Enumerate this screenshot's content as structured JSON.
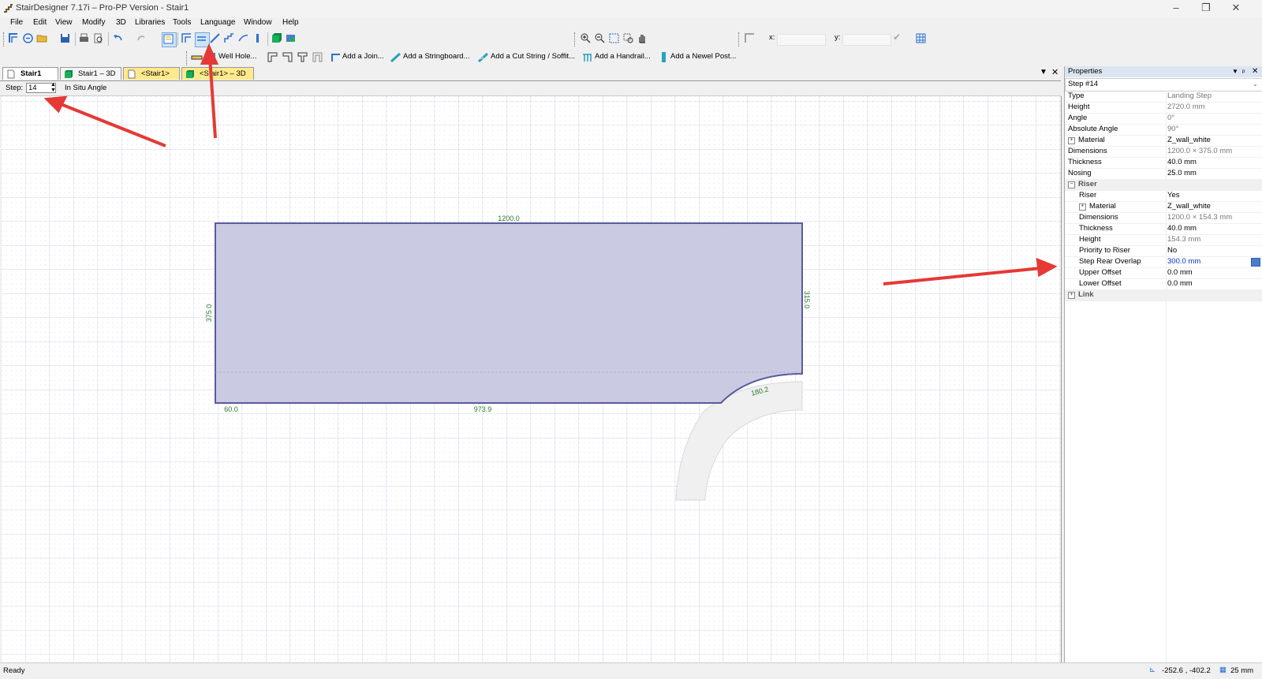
{
  "window": {
    "title": "StairDesigner 7.17i – Pro-PP Version - Stair1"
  },
  "menu": [
    "File",
    "Edit",
    "View",
    "Modify",
    "3D",
    "Libraries",
    "Tools",
    "Language",
    "Window",
    "Help"
  ],
  "toolbar2": {
    "well_hole": "Well Hole...",
    "add_join": "Add a Join...",
    "add_stringboard": "Add a Stringboard...",
    "add_cut_string": "Add a Cut String / Soffit...",
    "add_handrail": "Add a Handrail...",
    "add_newel": "Add a Newel Post..."
  },
  "coords": {
    "x_label": "x:",
    "y_label": "y:"
  },
  "tabs": [
    {
      "label": "Stair1",
      "active": true
    },
    {
      "label": "Stair1 – 3D"
    },
    {
      "label": "<Stair1>"
    },
    {
      "label": "<Stair1> – 3D"
    }
  ],
  "stepbar": {
    "label": "Step:",
    "value": "14",
    "mode": "In Situ Angle"
  },
  "drawing": {
    "dim_top": "1200.0",
    "dim_left": "375.0",
    "dim_right": "315.0",
    "dim_bottom_left": "60.0",
    "dim_bottom": "973.9",
    "dim_arc": "180.2",
    "colors": {
      "step_fill": "#c7c8e0",
      "step_stroke": "#5a5a9e",
      "dimension": "#2a7a2a"
    }
  },
  "properties": {
    "title": "Properties",
    "selected": "Step #14",
    "rows": [
      {
        "name": "Type",
        "value": "Landing Step"
      },
      {
        "name": "Height",
        "value": "2720.0 mm"
      },
      {
        "name": "Angle",
        "value": "0°"
      },
      {
        "name": "Absolute Angle",
        "value": "90°"
      },
      {
        "name": "Material",
        "value": "Z_wall_white"
      },
      {
        "name": "Dimensions",
        "value": "1200.0 × 375.0 mm"
      },
      {
        "name": "Thickness",
        "value": "40.0 mm"
      },
      {
        "name": "Nosing",
        "value": "25.0 mm"
      },
      {
        "name": "Riser",
        "value": ""
      },
      {
        "name": "Riser",
        "value": "Yes"
      },
      {
        "name": "Material",
        "value": "Z_wall_white"
      },
      {
        "name": "Dimensions",
        "value": "1200.0 × 154.3 mm"
      },
      {
        "name": "Thickness",
        "value": "40.0 mm"
      },
      {
        "name": "Height",
        "value": "154.3 mm"
      },
      {
        "name": "Priority to Riser",
        "value": "No"
      },
      {
        "name": "Step Rear Overlap",
        "value": "300.0 mm"
      },
      {
        "name": "Upper Offset",
        "value": "0.0 mm"
      },
      {
        "name": "Lower Offset",
        "value": "0.0 mm"
      },
      {
        "name": "Link",
        "value": ""
      }
    ]
  },
  "status": {
    "text": "Ready",
    "cursor": "-252.6 , -402.2",
    "grid": "25 mm"
  }
}
